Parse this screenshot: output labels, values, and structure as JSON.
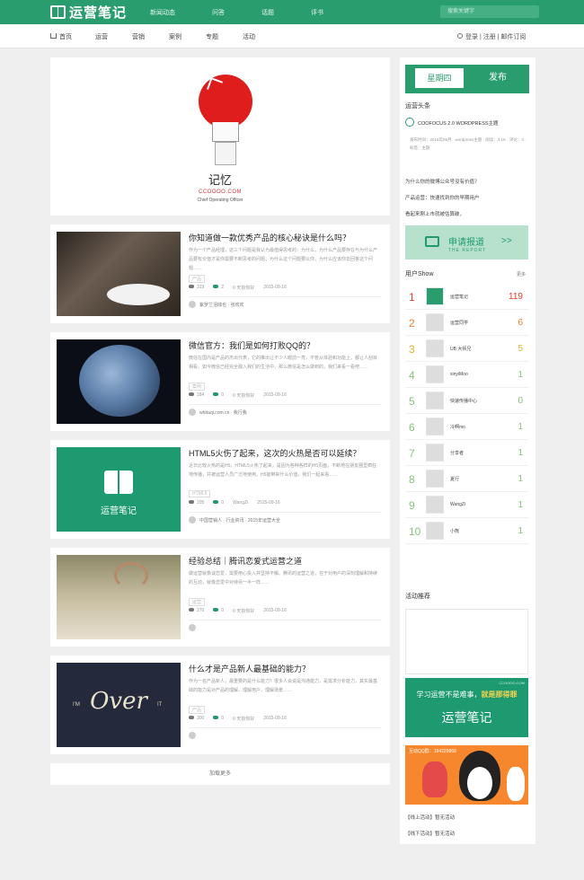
{
  "header": {
    "logo_text": "运营笔记",
    "nav": [
      "新闻动态",
      "问答",
      "话题",
      "评书"
    ],
    "search_placeholder": "搜索关键字"
  },
  "subnav": {
    "home": "首页",
    "items": [
      "运营",
      "营销",
      "案例",
      "专题",
      "活动"
    ],
    "user_links": "登录 | 注册 | 邮件订阅"
  },
  "hero": {
    "title": "记忆",
    "domain": "CCOOOO.COM",
    "subtitle": "Chief Operating Officer"
  },
  "posts": [
    {
      "title": "你知道做一款优秀产品的核心秘诀是什么吗？",
      "excerpt": "作为一个产品经理，这三个问题是我认为最值得思考的：为什么，为什么产品要存在与为什么产品要有价值才是你需要不断思考的问题；为什么这个问题要以你，为什么应该你去回答这个问题……",
      "tag": "产品",
      "views": "319",
      "comments": "2",
      "likes": "0 天前你好",
      "date": "2015-09-16",
      "author": "紫罗兰泪烛也 · 张欢欢"
    },
    {
      "title": "微信官方：我们是如何打败QQ的？",
      "excerpt": "微信在国内是产品的杰出代表，它的推出让不少人眼前一亮，不管从体验和功能上，都让人刮目相看，如今微信已经完全融入我们的生活中，那么微信是怎么做到的，我们来看一看吧……",
      "tag": "案例",
      "views": "184",
      "comments": "0",
      "likes": "0 天前你好",
      "date": "2015-09-16",
      "author": "whttaqi.com.cn · 我行我",
      "date_alt": ""
    },
    {
      "title": "HTML5火伤了起来，这次的火热是否可以延续？",
      "excerpt": "近日比较火热的是H5，HTML5火热了起来，是因为各种各样的H5页面，不断地在朋友圈里疯狂地传播，并被运营人员广泛地使用，H5能带来什么价值，我们一起来看……",
      "tag": "HTML5",
      "views": "205",
      "comments": "0",
      "likes": "WangZi",
      "date": "2015-09-16",
      "author": "中国营销人 · 行业资讯 · 2015年运营大全"
    },
    {
      "title": "经验总结｜腾讯恋爱式运营之道",
      "excerpt": "做运营就像谈恋爱，需要用心投入并坚持不懈。腾讯的运营之道，在于对用户的深刻理解和持续的互动，就像恋爱中对待另一半一样……",
      "tag": "运营",
      "views": "270",
      "comments": "0",
      "likes": "0 天前你好",
      "date": "2015-09-16",
      "author": ""
    },
    {
      "title": "什么才是产品新人最基础的能力？",
      "excerpt": "作为一名产品新人，最重要的是什么能力？很多人会说是沟通能力，是需求分析能力，其实最基础的能力是对产品的理解，理解用户，理解场景……",
      "tag": "产品",
      "views": "300",
      "comments": "0",
      "likes": "0 天前你好",
      "date": "2015-09-16",
      "author": ""
    }
  ],
  "thumbs": {
    "green_label": "运营笔记",
    "over_text": "Over",
    "im": "I'M",
    "it": "IT"
  },
  "load_more": "加载更多",
  "sidebar": {
    "tabs": [
      "星期四",
      "发布"
    ],
    "headline_title": "运营头条",
    "headline_item": "COOFOCUS 2.0 WORDPRESS主题",
    "headline_meta": "发布时间：2015年09月 · wordpress主题 · 阅读：3.1K · 评论：0 · 标签：主题",
    "links": [
      "为什么你的微博公众号没有价值？",
      "产品运营：快速找到你的早期用户",
      "看起来刚上市就被估算破，"
    ],
    "banner_main": "申请报道",
    "banner_sub": "THE REPORT",
    "show_title": "用户Show",
    "show_more": "更多",
    "ranking": [
      {
        "n": "1",
        "name": "运营笔记",
        "score": "119"
      },
      {
        "n": "2",
        "name": "运营同学",
        "score": "6"
      },
      {
        "n": "3",
        "name": "UB 大师兄",
        "score": "5"
      },
      {
        "n": "4",
        "name": "xinyiMoo",
        "score": "1"
      },
      {
        "n": "5",
        "name": "快速传播中心",
        "score": "0"
      },
      {
        "n": "6",
        "name": "冷啊mo",
        "score": "1"
      },
      {
        "n": "7",
        "name": "分享者",
        "score": "1"
      },
      {
        "n": "8",
        "name": "夏行",
        "score": "1"
      },
      {
        "n": "9",
        "name": "WangZi",
        "score": "1"
      },
      {
        "n": "10",
        "name": "小熊",
        "score": "1"
      }
    ],
    "activities_title": "活动推荐",
    "ad1_top": "CCOOOO.COM",
    "ad1_line_a": "学习运营不是难事，",
    "ad1_line_b": "就是那得罪",
    "ad1_brand": "运营笔记",
    "ad2_text": "互动QQ群：194229869",
    "footer_links": [
      "【线上活动】暂无活动",
      "【线下活动】暂无活动"
    ]
  },
  "colors": {
    "brand": "#2a9d6e",
    "accent_red": "#e01d1d",
    "rank_1": "#e43a2a",
    "rank_2": "#f07a2a",
    "rank_3": "#e3b02a",
    "rank_other": "#88c37a"
  }
}
